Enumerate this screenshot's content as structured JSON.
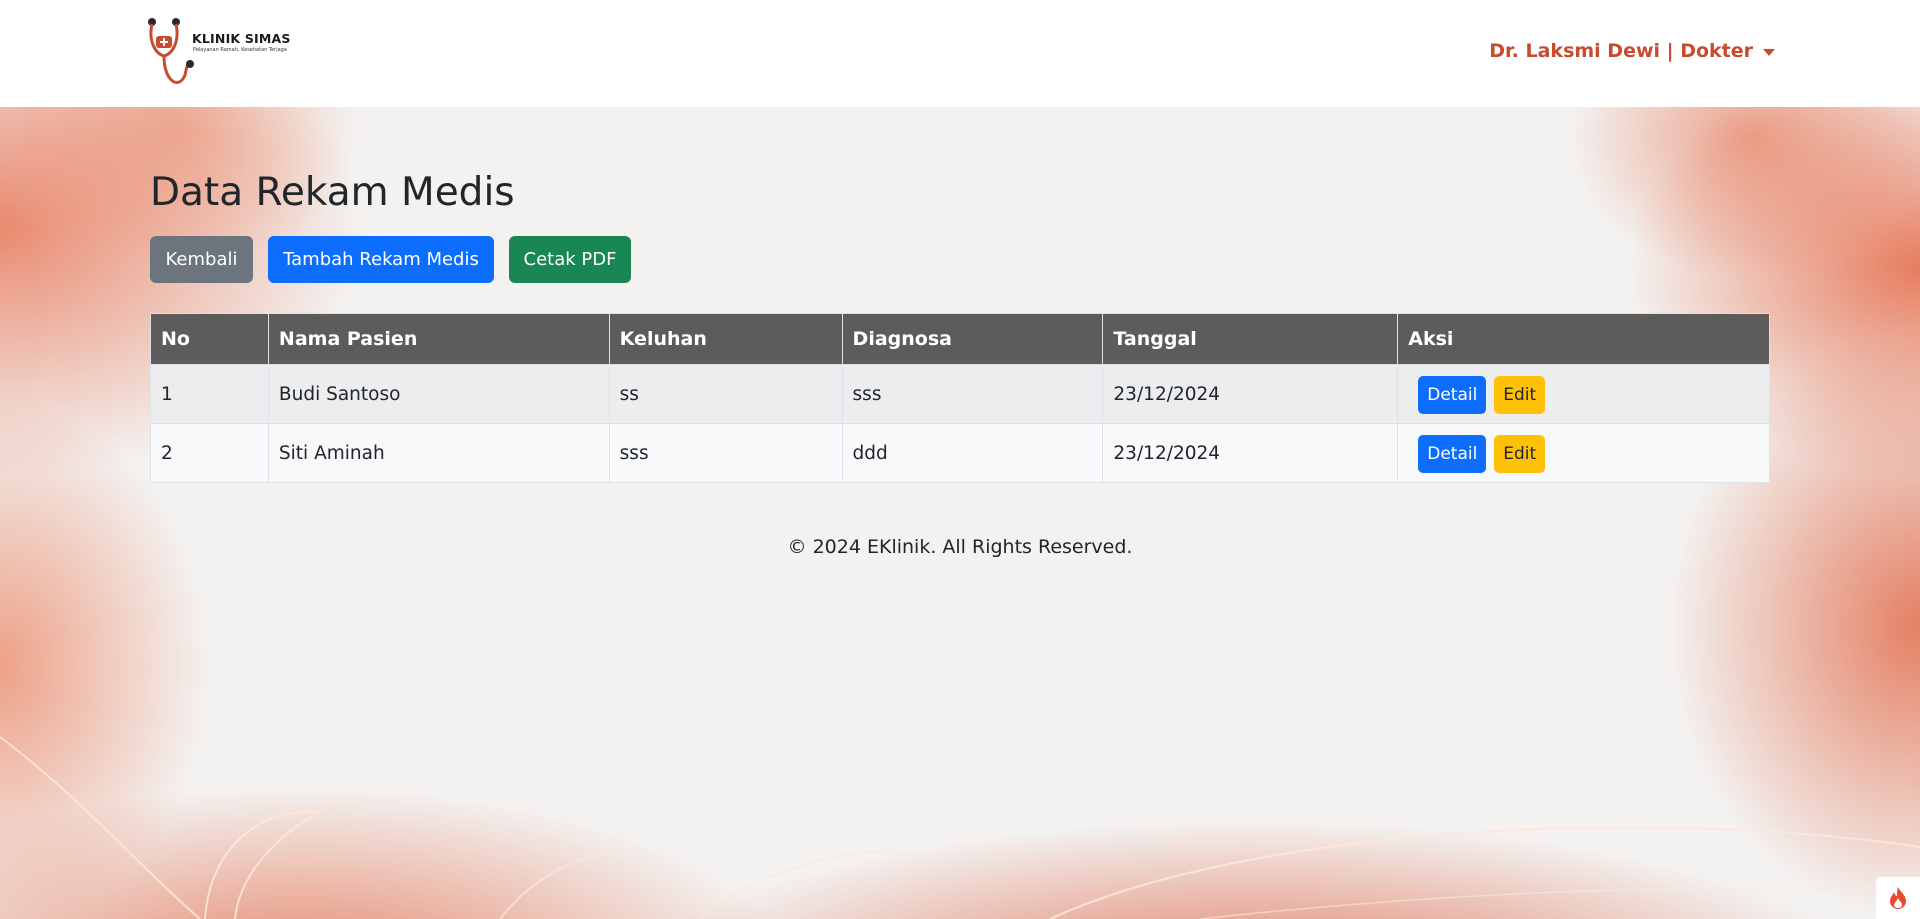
{
  "navbar": {
    "brand_title": "KLINIK SIMAS",
    "brand_subtitle": "Pelayanan Ramah, Kesehatan Terjaga",
    "user_label": "Dr. Laksmi Dewi | Dokter"
  },
  "page": {
    "title": "Data Rekam Medis",
    "buttons": {
      "back": "Kembali",
      "add": "Tambah Rekam Medis",
      "print": "Cetak PDF"
    }
  },
  "table": {
    "headers": [
      "No",
      "Nama Pasien",
      "Keluhan",
      "Diagnosa",
      "Tanggal",
      "Aksi"
    ],
    "rows": [
      {
        "no": "1",
        "nama": "Budi Santoso",
        "keluhan": "ss",
        "diagnosa": "sss",
        "tanggal": "23/12/2024",
        "detail": "Detail",
        "edit": "Edit"
      },
      {
        "no": "2",
        "nama": "Siti Aminah",
        "keluhan": "sss",
        "diagnosa": "ddd",
        "tanggal": "23/12/2024",
        "detail": "Detail",
        "edit": "Edit"
      }
    ]
  },
  "footer": {
    "text": "© 2024 EKlinik. All Rights Reserved."
  },
  "colors": {
    "brand_accent": "#c64b2f",
    "table_header": "#5e5c5a",
    "btn_primary": "#0d6efd",
    "btn_secondary": "#6c757d",
    "btn_success": "#198754",
    "btn_warning": "#ffc107"
  },
  "icons": {
    "logo": "stethoscope-logo",
    "corner": "flame-icon"
  }
}
